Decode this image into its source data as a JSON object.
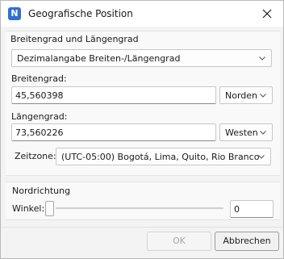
{
  "window": {
    "title": "Geografische Position",
    "app_icon": "N",
    "close_icon": "close-icon"
  },
  "group_coordinates": {
    "title": "Breitengrad und Längengrad",
    "format_select": "Dezimalangabe Breiten-/Längengrad",
    "latitude_label": "Breitengrad:",
    "latitude_value": "45,560398",
    "latitude_direction": "Norden",
    "longitude_label": "Längengrad:",
    "longitude_value": "73,560226",
    "longitude_direction": "Westen",
    "timezone_label": "Zeitzone:",
    "timezone_value": "(UTC-05:00) Bogotá, Lima, Quito, Rio Branco"
  },
  "group_north": {
    "title": "Nordrichtung",
    "angle_label": "Winkel:",
    "angle_value": "0",
    "angle_slider_position": 0
  },
  "buttons": {
    "ok": "OK",
    "cancel": "Abbrechen"
  },
  "colors": {
    "accent": "#2f6fd2",
    "background": "#f3f3f3",
    "panel": "#f9f9f9"
  }
}
